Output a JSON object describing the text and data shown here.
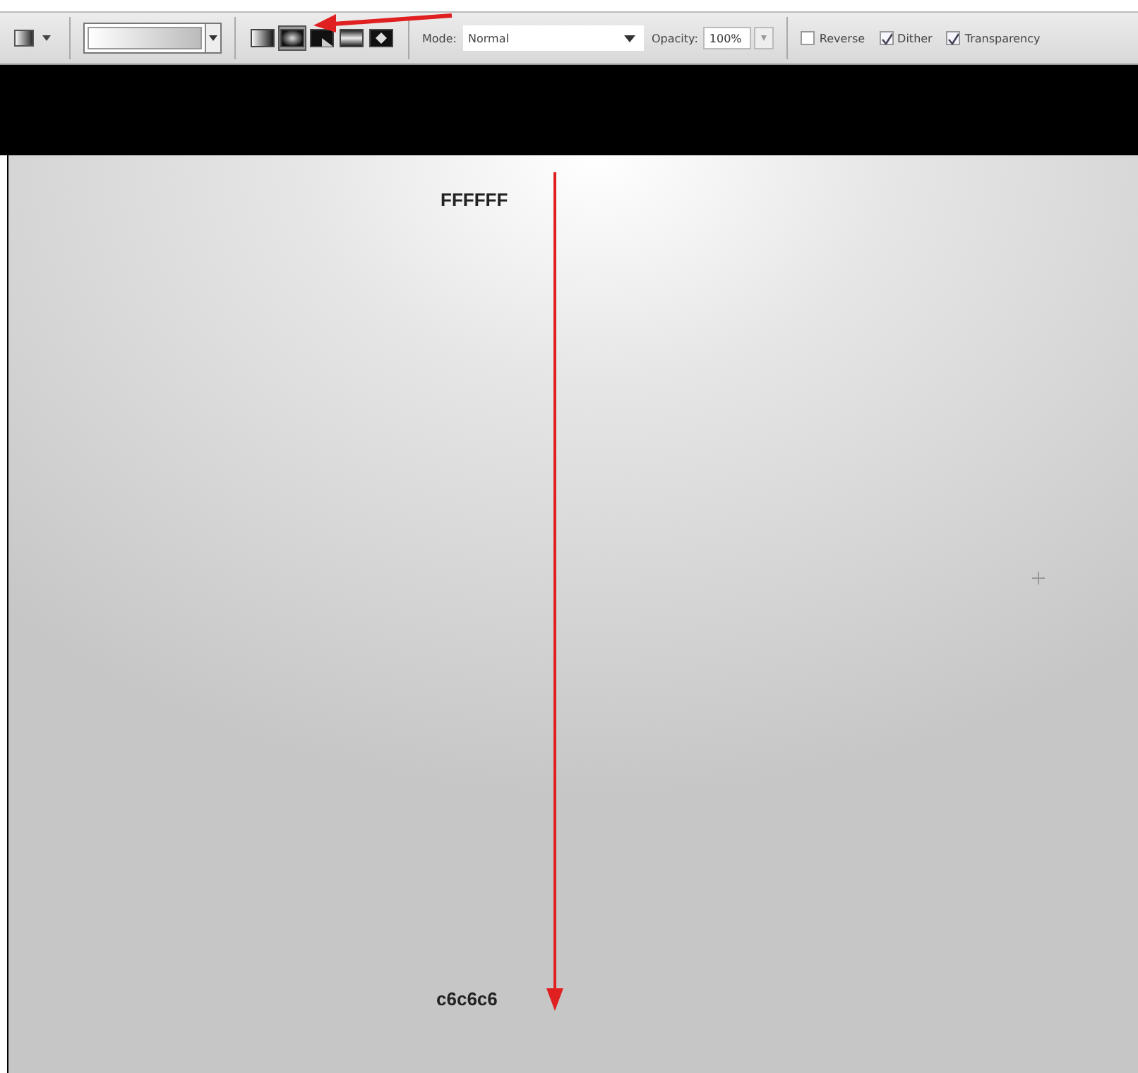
{
  "toolbar": {
    "gradient_types": [
      {
        "kind": "linear",
        "selected": false
      },
      {
        "kind": "radial",
        "selected": true
      },
      {
        "kind": "angle",
        "selected": false
      },
      {
        "kind": "reflected",
        "selected": false
      },
      {
        "kind": "diamond",
        "selected": false
      }
    ],
    "mode": {
      "label": "Mode:",
      "value": "Normal"
    },
    "opacity": {
      "label": "Opacity:",
      "value": "100%"
    },
    "options": [
      {
        "label": "Reverse",
        "checked": false
      },
      {
        "label": "Dither",
        "checked": true
      },
      {
        "label": "Transparency",
        "checked": true
      }
    ]
  },
  "canvas": {
    "start_label": "FFFFFF",
    "end_label": "c6c6c6"
  }
}
